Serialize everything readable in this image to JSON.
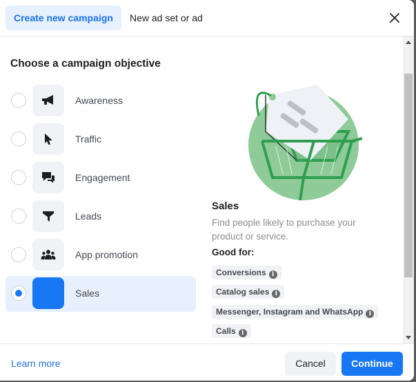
{
  "header": {
    "tabs": [
      {
        "label": "Create new campaign",
        "active": true
      },
      {
        "label": "New ad set or ad",
        "active": false
      }
    ],
    "close_icon": "close-icon"
  },
  "main": {
    "title": "Choose a campaign objective",
    "objectives": [
      {
        "label": "Awareness",
        "icon": "megaphone-icon",
        "selected": false
      },
      {
        "label": "Traffic",
        "icon": "cursor-icon",
        "selected": false
      },
      {
        "label": "Engagement",
        "icon": "chat-bubbles-icon",
        "selected": false
      },
      {
        "label": "Leads",
        "icon": "funnel-icon",
        "selected": false
      },
      {
        "label": "App promotion",
        "icon": "people-icon",
        "selected": false
      },
      {
        "label": "Sales",
        "icon": "shopping-bag-icon",
        "selected": true
      }
    ]
  },
  "detail": {
    "title": "Sales",
    "description": "Find people likely to purchase your product or service.",
    "good_for_label": "Good for:",
    "chips": [
      "Conversions",
      "Catalog sales",
      "Messenger, Instagram and WhatsApp",
      "Calls"
    ],
    "info_glyph": "i"
  },
  "footer": {
    "learn_more": "Learn more",
    "cancel": "Cancel",
    "continue": "Continue"
  },
  "colors": {
    "accent": "#1877f2",
    "selected_bg": "#e7f0fd",
    "illustration_green": "#8fcb98"
  }
}
